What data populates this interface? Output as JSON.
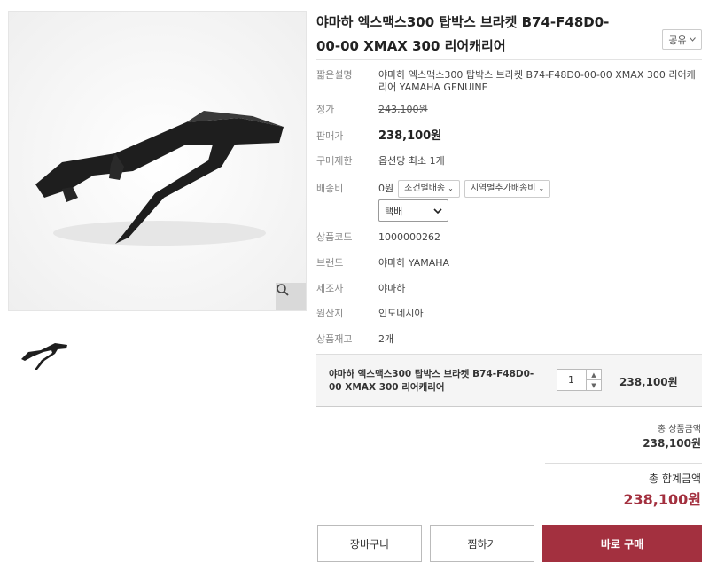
{
  "product": {
    "title": "야마하 엑스맥스300 탑박스 브라켓 B74-F48D0-00-00 XMAX 300 리어캐리어",
    "share_label": "공유"
  },
  "details": {
    "short_desc_label": "짧은설명",
    "short_desc": "야마하 엑스맥스300 탑박스 브라켓 B74-F48D0-00-00 XMAX 300 리어캐리어 YAMAHA GENUINE",
    "list_price_label": "정가",
    "list_price": "243,100원",
    "sale_price_label": "판매가",
    "sale_price": "238,100원",
    "purchase_limit_label": "구매제한",
    "purchase_limit": "옵션당 최소 1개",
    "shipping_label": "배송비",
    "shipping_fee": "0원",
    "shipping_cond": "조건별배송",
    "shipping_region": "지역별추가배송비",
    "shipping_method": "택배",
    "code_label": "상품코드",
    "code": "1000000262",
    "brand_label": "브랜드",
    "brand": "야마하 YAMAHA",
    "maker_label": "제조사",
    "maker": "야마하",
    "origin_label": "원산지",
    "origin": "인도네시아",
    "stock_label": "상품재고",
    "stock": "2개"
  },
  "option": {
    "name": "야마하 엑스맥스300 탑박스 브라켓 B74-F48D0-00 XMAX 300 리어캐리어",
    "quantity": "1",
    "price": "238,100원"
  },
  "summary": {
    "subtotal_label": "총 상품금액",
    "subtotal": "238,100원",
    "total_label": "총 합계금액",
    "total": "238,100원"
  },
  "buttons": {
    "cart": "장바구니",
    "wish": "찜하기",
    "buy": "바로 구매"
  },
  "colors": {
    "accent": "#a3303f"
  },
  "icons": {
    "zoom": "magnifier-icon",
    "share": "chevron-down-icon"
  }
}
